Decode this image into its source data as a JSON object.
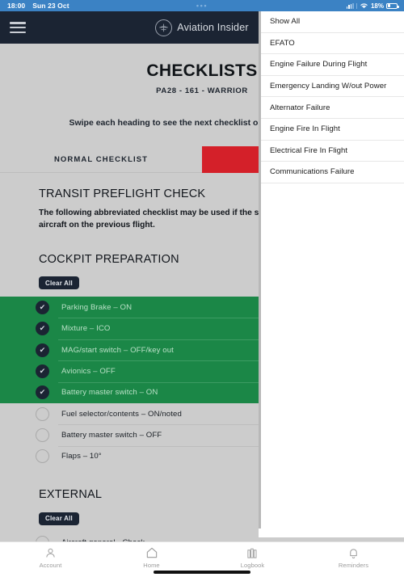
{
  "status_bar": {
    "time": "18:00",
    "date": "Sun 23 Oct",
    "dots": "•••",
    "battery_percent": "18%",
    "wifi_icon": "wifi-icon",
    "signal_icon": "cellular-signal-icon",
    "battery_icon": "battery-icon"
  },
  "navbar": {
    "menu_icon": "hamburger-menu-icon",
    "brand_icon": "aviation-insider-logo-icon",
    "brand_name": "Aviation Insider",
    "brand_background": "#1b2433"
  },
  "header": {
    "title": "CHECKLISTS",
    "subtitle": "PA28 - 161 - WARRIOR",
    "swipe_hint": "Swipe each heading to see the next checklist or use the tab below"
  },
  "tabs": [
    {
      "label": "NORMAL CHECKLIST",
      "active": false,
      "color": "#cccccc"
    },
    {
      "label": "",
      "active": true,
      "color": "#d42029"
    }
  ],
  "content": {
    "transit_heading": "TRANSIT PREFLIGHT CHECK",
    "transit_description": "The following abbreviated checklist may be used if the same pilot has flown the aircraft on the previous flight.",
    "clear_all_label": "Clear All",
    "sections": [
      {
        "title": "COCKPIT PREPARATION",
        "items": [
          {
            "label": "Parking Brake – ON",
            "checked": true
          },
          {
            "label": "Mixture – ICO",
            "checked": true
          },
          {
            "label": "MAG/start switch – OFF/key out",
            "checked": true
          },
          {
            "label": "Avionics – OFF",
            "checked": true
          },
          {
            "label": "Battery master switch – ON",
            "checked": true
          },
          {
            "label": "Fuel selector/contents – ON/noted",
            "checked": false
          },
          {
            "label": "Battery master switch – OFF",
            "checked": false
          },
          {
            "label": "Flaps – 10°",
            "checked": false
          }
        ]
      },
      {
        "title": "EXTERNAL",
        "items": [
          {
            "label": "Aircraft general - Check",
            "checked": false
          }
        ]
      }
    ],
    "check_glyph": "✔"
  },
  "dropdown": {
    "items": [
      {
        "label": "Show All"
      },
      {
        "label": "EFATO"
      },
      {
        "label": "Engine Failure During Flight"
      },
      {
        "label": "Emergency Landing W/out Power"
      },
      {
        "label": "Alternator Failure"
      },
      {
        "label": "Engine Fire In Flight"
      },
      {
        "label": "Electrical Fire In Flight"
      },
      {
        "label": "Communications Failure"
      }
    ]
  },
  "tabbar": {
    "items": [
      {
        "label": "Account",
        "icon": "account-icon"
      },
      {
        "label": "Home",
        "icon": "home-icon"
      },
      {
        "label": "Logbook",
        "icon": "logbook-icon"
      },
      {
        "label": "Reminders",
        "icon": "reminders-bell-icon"
      }
    ]
  }
}
